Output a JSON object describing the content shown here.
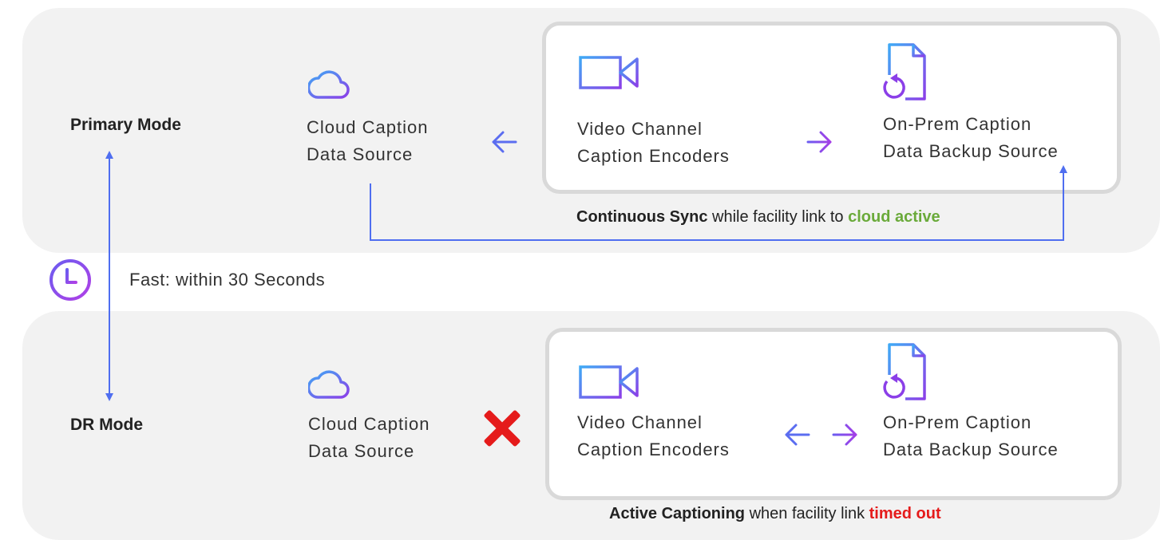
{
  "modes": {
    "primary": "Primary Mode",
    "dr": "DR Mode"
  },
  "timing": {
    "text": "Fast: within 30 Seconds"
  },
  "primary": {
    "cloud": {
      "line1": "Cloud Caption",
      "line2": "Data Source"
    },
    "encoders": {
      "line1": "Video Channel",
      "line2": "Caption Encoders"
    },
    "backup": {
      "line1": "On-Prem Caption",
      "line2": "Data Backup Source"
    },
    "caption": {
      "bold": "Continuous Sync",
      "middle": " while facility link to ",
      "status": "cloud active"
    }
  },
  "dr": {
    "cloud": {
      "line1": "Cloud Caption",
      "line2": "Data Source"
    },
    "encoders": {
      "line1": "Video Channel",
      "line2": "Caption Encoders"
    },
    "backup": {
      "line1": "On-Prem Caption",
      "line2": "Data Backup Source"
    },
    "caption": {
      "bold": "Active Captioning",
      "middle": " when facility link ",
      "status": "timed out"
    }
  },
  "colors": {
    "blue": "#4f6ef0",
    "purple": "#9b3fe8",
    "green": "#6aaa3a",
    "red": "#e51b1b",
    "panel": "#f2f2f2"
  },
  "icons": [
    "cloud-icon",
    "video-camera-icon",
    "document-restore-icon",
    "clock-icon",
    "failure-x-icon"
  ]
}
